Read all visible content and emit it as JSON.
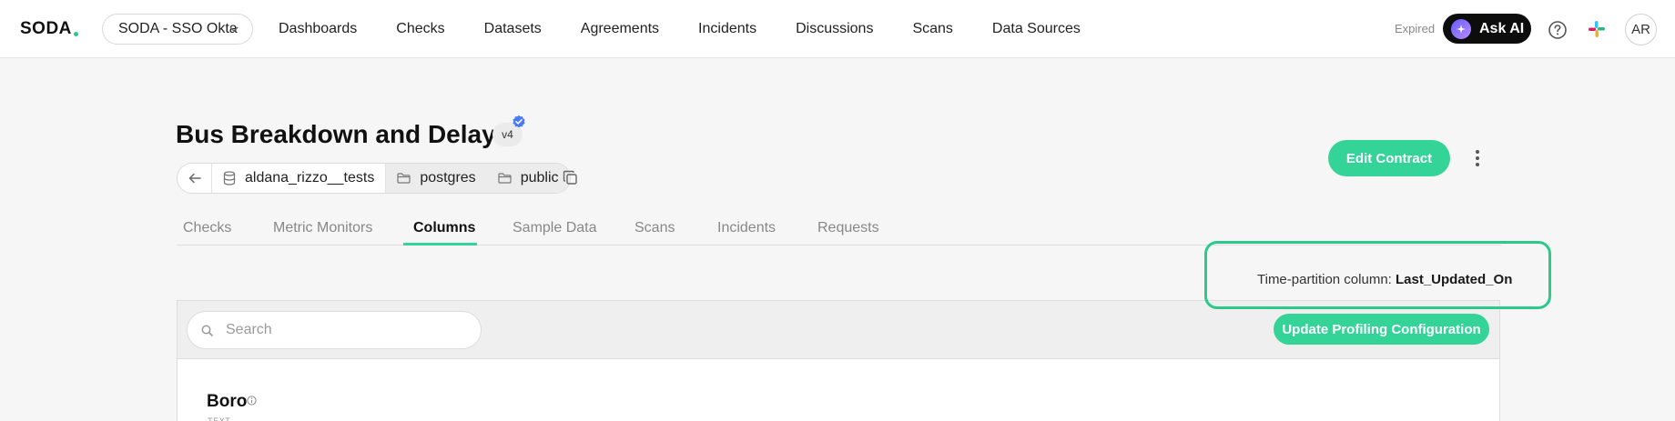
{
  "brand": {
    "logo_text": "SODA",
    "accent": "#34d398"
  },
  "org_select": {
    "value": "SODA - SSO Okta"
  },
  "nav": {
    "items": [
      "Dashboards",
      "Checks",
      "Datasets",
      "Agreements",
      "Incidents",
      "Discussions",
      "Scans",
      "Data Sources"
    ]
  },
  "header_right": {
    "expired_label": "Expired",
    "ask_ai_label": "Ask AI",
    "avatar_initials": "AR"
  },
  "dataset": {
    "title": "Bus Breakdown and Delays",
    "version": "v4",
    "breadcrumb": {
      "datasource": "aldana_rizzo__tests",
      "database": "postgres",
      "schema": "public"
    },
    "edit_contract_label": "Edit Contract"
  },
  "tabs": {
    "items": [
      "Checks",
      "Metric Monitors",
      "Columns",
      "Sample Data",
      "Scans",
      "Incidents",
      "Requests"
    ],
    "active": "Columns"
  },
  "partition": {
    "label": "Time-partition column:",
    "value": "Last_Updated_On"
  },
  "columns_panel": {
    "search_placeholder": "Search",
    "update_button_label": "Update Profiling Configuration",
    "first_column": {
      "name": "Boro",
      "type": "TEXT"
    }
  },
  "icons": {
    "back": "arrow-left-icon",
    "database": "database-icon",
    "folder": "folder-icon",
    "copy": "copy-icon",
    "verified": "verified-badge-icon",
    "kebab": "more-vertical-icon",
    "help": "help-icon",
    "slack": "slack-icon",
    "search": "search-icon",
    "info": "info-icon"
  }
}
